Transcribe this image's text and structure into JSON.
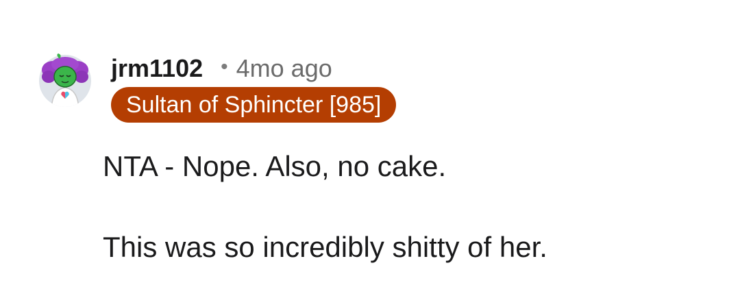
{
  "comment": {
    "author": "jrm1102",
    "separator": "•",
    "age": "4mo ago",
    "flair": {
      "text": "Sultan of Sphincter [985]",
      "background_color": "#b43e02",
      "text_color": "#ffffff"
    },
    "avatar": {
      "icon": "snoo-avatar-icon",
      "hair_color": "#9b3fc6",
      "skin_color": "#3bb54a"
    },
    "paragraphs": [
      "NTA - Nope. Also, no cake.",
      "This was so incredibly shitty of her."
    ]
  }
}
